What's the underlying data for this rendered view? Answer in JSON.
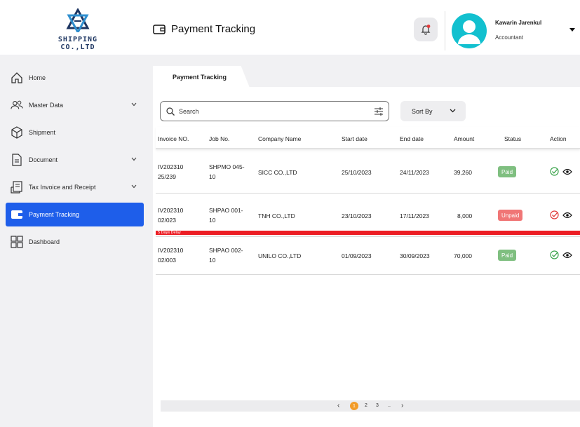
{
  "brand": {
    "name": "SHIPPING CO.,LTD"
  },
  "header": {
    "title": "Payment Tracking",
    "user": {
      "name": "Kawarin Jarenkul",
      "role": "Accountant"
    }
  },
  "sidebar": {
    "items": [
      {
        "label": "Home",
        "icon": "home-icon"
      },
      {
        "label": "Master Data",
        "icon": "users-icon"
      },
      {
        "label": "Shipment",
        "icon": "box-icon"
      },
      {
        "label": "Document",
        "icon": "document-icon"
      },
      {
        "label": "Tax Invoice and Receipt",
        "icon": "receipt-icon"
      },
      {
        "label": "Payment Tracking",
        "icon": "wallet-icon",
        "active": true
      },
      {
        "label": "Dashboard",
        "icon": "dashboard-icon"
      }
    ]
  },
  "tab": {
    "label": "Payment Tracking"
  },
  "search": {
    "placeholder": "Search",
    "value": ""
  },
  "sort": {
    "label": "Sort By"
  },
  "table": {
    "columns": [
      "Invoice NO.",
      "Job No.",
      "Company Name",
      "Start date",
      "End date",
      "Amount",
      "Status",
      "Action"
    ],
    "rows": [
      {
        "invoice": "IV202310 25/239",
        "job": "SHPMO 045-10",
        "company": "SICC CO.,LTD",
        "start": "25/10/2023",
        "end": "24/11/2023",
        "amount": "39,260",
        "status": "Paid"
      },
      {
        "invoice": "IV202310 02/023",
        "job": "SHPAO 001-10",
        "company": "TNH CO.,LTD",
        "start": "23/10/2023",
        "end": "17/11/2023",
        "amount": "8,000",
        "status": "Unpaid",
        "delay": "5 Days Delay"
      },
      {
        "invoice": "IV202310 02/003",
        "job": "SHPAO 002-10",
        "company": "UNILO CO.,LTD",
        "start": "01/09/2023",
        "end": "30/09/2023",
        "amount": "70,000",
        "status": "Paid"
      }
    ]
  },
  "pagination": {
    "prev": "‹",
    "current": "1",
    "pages": [
      "2",
      "3"
    ],
    "ellipsis": "..",
    "next": "›"
  },
  "colors": {
    "accent": "#1e5eea",
    "paid": "#7fbf80",
    "unpaid": "#f07676",
    "delay": "#ec1d24",
    "avatar": "#12c0cf",
    "page_current": "#f29b27"
  }
}
